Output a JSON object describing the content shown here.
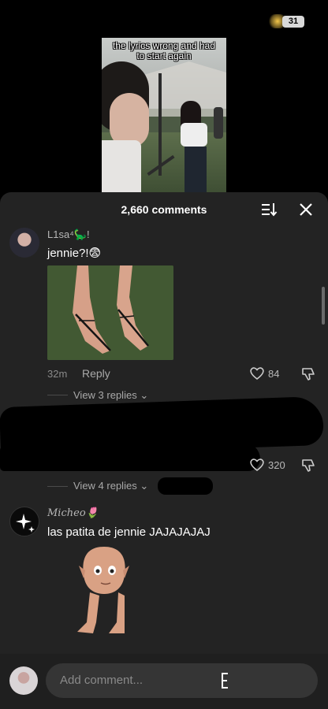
{
  "status_bar": {
    "battery": "31"
  },
  "video": {
    "caption_line1": "the lyrics wrong and had",
    "caption_line2": "to start again"
  },
  "comments_header": {
    "count": "2,660 comments"
  },
  "comments": [
    {
      "username": "L1sa⁴🦕!",
      "text": "jennie?!😨",
      "time": "32m",
      "reply_label": "Reply",
      "likes": "84",
      "view_replies": "View 3 replies"
    },
    {
      "likes": "320",
      "view_replies": "View 4 replies"
    },
    {
      "username": "Micheo🌷",
      "text": "las patita de jennie JAJAJAJAJ"
    }
  ],
  "input": {
    "placeholder": "Add comment..."
  },
  "colors": {
    "sheet_bg": "#232323",
    "text_secondary": "#8a8a8a"
  }
}
